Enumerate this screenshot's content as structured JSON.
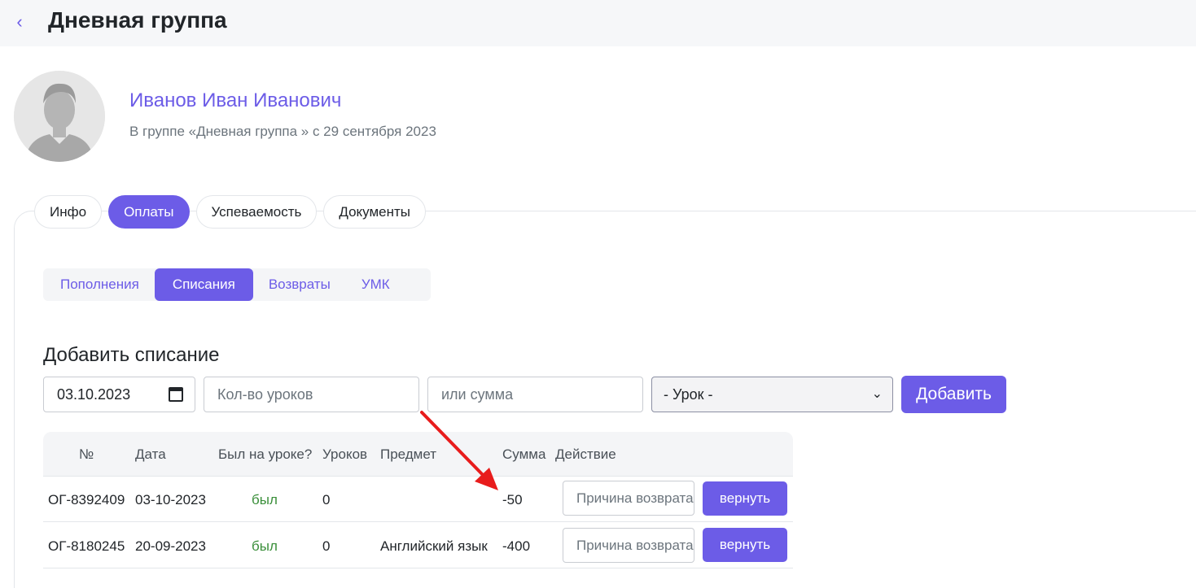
{
  "header": {
    "back_icon": "chevron-left-icon",
    "title": "Дневная группа"
  },
  "student": {
    "name": "Иванов Иван Иванович",
    "subtitle": "В группе «Дневная группа » с 29 сентября 2023"
  },
  "tabs": [
    {
      "label": "Инфо",
      "active": false
    },
    {
      "label": "Оплаты",
      "active": true
    },
    {
      "label": "Успеваемость",
      "active": false
    },
    {
      "label": "Документы",
      "active": false
    }
  ],
  "subtabs": [
    {
      "label": "Пополнения",
      "active": false
    },
    {
      "label": "Списания",
      "active": true
    },
    {
      "label": "Возвраты",
      "active": false
    },
    {
      "label": "УМК",
      "active": false
    }
  ],
  "form": {
    "title": "Добавить списание",
    "date_value": "03.10.2023",
    "lessons_placeholder": "Кол-во уроков",
    "sum_placeholder": "или сумма",
    "lesson_select": "- Урок -",
    "add_label": "Добавить"
  },
  "table": {
    "columns": [
      "№",
      "Дата",
      "Был на уроке?",
      "Уроков",
      "Предмет",
      "Сумма",
      "Действие"
    ],
    "rows": [
      {
        "id": "ОГ-8392409",
        "date": "03-10-2023",
        "attended": "был",
        "lessons": "0",
        "subject": "",
        "sum": "-50",
        "reason_placeholder": "Причина возврата",
        "action": "вернуть"
      },
      {
        "id": "ОГ-8180245",
        "date": "20-09-2023",
        "attended": "был",
        "lessons": "0",
        "subject": "Английский язык",
        "sum": "-400",
        "reason_placeholder": "Причина возврата",
        "action": "вернуть"
      }
    ]
  },
  "colors": {
    "accent": "#6c5ce7",
    "attended": "#3a8f3a",
    "annotation_arrow": "#e81c1c"
  }
}
